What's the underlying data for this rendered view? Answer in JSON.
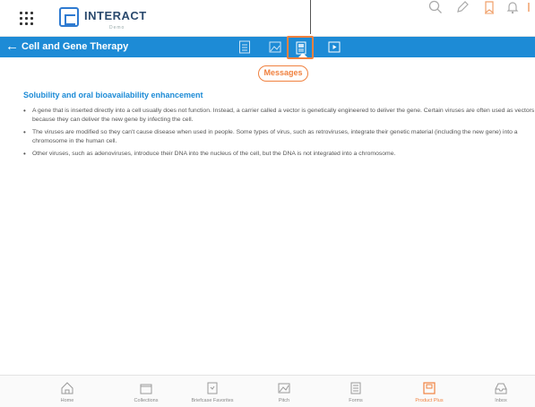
{
  "app": {
    "logo_text": "INTERACT",
    "logo_sub": "Demo"
  },
  "top_icons": [
    "search-icon",
    "pencil-icon",
    "bookmark-icon",
    "bell-icon",
    "more-icon"
  ],
  "header": {
    "back_icon": "←",
    "title": "Cell and Gene Therapy",
    "tools": [
      "document-icon",
      "image-icon",
      "messages-icon",
      "video-icon"
    ],
    "selected_tool": "messages-icon"
  },
  "messages_pill": "Messages",
  "content": {
    "section_title": "Solubility and oral bioavailability enhancement",
    "bullets": [
      "A gene that is inserted directly into a cell usually does not function. Instead, a carrier called a vector is genetically engineered to deliver the gene. Certain viruses are often used as vectors because they can deliver the new gene by infecting the cell.",
      "The viruses are modified so they can't cause disease when used in people. Some types of virus, such as retroviruses, integrate their genetic material (including the new gene) into a chromosome in the human cell.",
      "Other viruses, such as adenoviruses, introduce their DNA into the nucleus of the cell, but the DNA is not integrated into a chromosome."
    ]
  },
  "bottom_nav": [
    {
      "label": "Home",
      "icon": "home-icon",
      "active": false
    },
    {
      "label": "Collections",
      "icon": "folder-icon",
      "active": false
    },
    {
      "label": "Briefcase Favorites",
      "icon": "briefcase-icon",
      "active": false
    },
    {
      "label": "Pitch",
      "icon": "pitch-icon",
      "active": false
    },
    {
      "label": "Forms",
      "icon": "forms-icon",
      "active": false
    },
    {
      "label": "Product Plus",
      "icon": "product-plus-icon",
      "active": true
    },
    {
      "label": "Inbox",
      "icon": "inbox-icon",
      "active": false
    }
  ],
  "colors": {
    "brand_blue": "#1d8bd6",
    "accent_orange": "#f0813f"
  }
}
